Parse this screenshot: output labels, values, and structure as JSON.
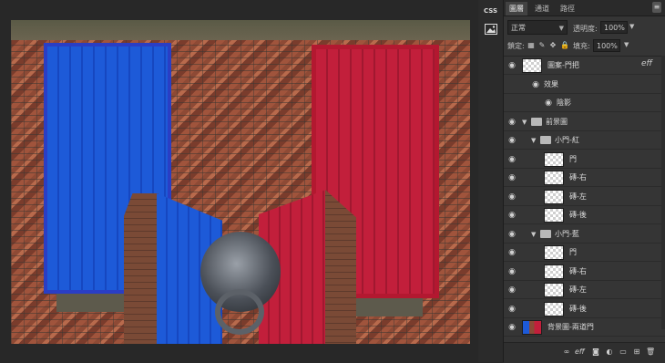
{
  "mini_panel": {
    "css_label": "CSS",
    "image_icon": "image-icon"
  },
  "tabs": [
    {
      "label": "圖層",
      "active": true
    },
    {
      "label": "通道",
      "active": false
    },
    {
      "label": "路徑",
      "active": false
    }
  ],
  "blend_mode": "正常",
  "opacity_label": "透明度:",
  "opacity_value": "100%",
  "lock_label": "鎖定:",
  "fill_label": "填充:",
  "fill_value": "100%",
  "layers": [
    {
      "name": "圖案-門把",
      "kind": "layer",
      "fx": "eff",
      "indent": 0
    },
    {
      "name": "效果",
      "kind": "effect-group",
      "indent": 1
    },
    {
      "name": "陰影",
      "kind": "effect",
      "indent": 2
    },
    {
      "name": "前景圖",
      "kind": "group",
      "indent": 0
    },
    {
      "name": "小門-紅",
      "kind": "group",
      "indent": 1
    },
    {
      "name": "門",
      "kind": "layer",
      "indent": 2
    },
    {
      "name": "磚-右",
      "kind": "layer",
      "indent": 2
    },
    {
      "name": "磚-左",
      "kind": "layer",
      "indent": 2
    },
    {
      "name": "磚-後",
      "kind": "layer",
      "indent": 2
    },
    {
      "name": "小門-藍",
      "kind": "group",
      "indent": 1
    },
    {
      "name": "門",
      "kind": "layer",
      "indent": 2
    },
    {
      "name": "磚-右",
      "kind": "layer",
      "indent": 2
    },
    {
      "name": "磚-左",
      "kind": "layer",
      "indent": 2
    },
    {
      "name": "磚-後",
      "kind": "layer",
      "indent": 2
    },
    {
      "name": "背景圖-兩道門",
      "kind": "layer",
      "indent": 0
    }
  ],
  "bottom_icons": [
    "link-icon",
    "fx-icon",
    "mask-icon",
    "adjustment-icon",
    "group-icon",
    "new-layer-icon",
    "trash-icon"
  ],
  "bottom_fx_label": "eff"
}
